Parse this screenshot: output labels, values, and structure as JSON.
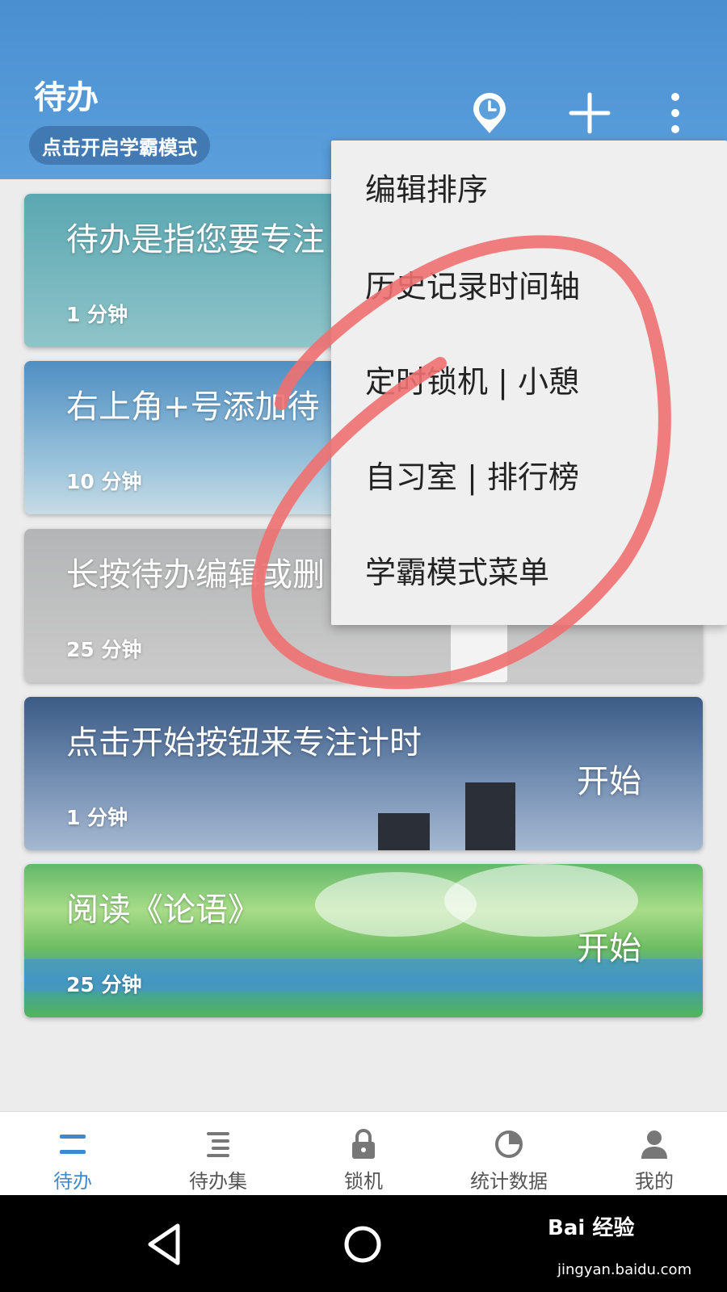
{
  "header": {
    "title": "待办",
    "mode_pill": "点击开启学霸模式",
    "icons": [
      "clock-icon",
      "plus-icon",
      "more-vertical-icon"
    ]
  },
  "cards": [
    {
      "title": "待办是指您要专注",
      "duration": "1 分钟",
      "start": ""
    },
    {
      "title": "右上角+号添加待",
      "duration": "10 分钟",
      "start": ""
    },
    {
      "title": "长按待办编辑或删",
      "duration": "25 分钟",
      "start": ""
    },
    {
      "title": "点击开始按钮来专注计时",
      "duration": "1 分钟",
      "start": "开始"
    },
    {
      "title": "阅读《论语》",
      "duration": "25 分钟",
      "start": "开始"
    }
  ],
  "menu": {
    "items": [
      "编辑排序",
      "历史记录时间轴",
      "定时锁机 | 小憩",
      "自习室 | 排行榜",
      "学霸模式菜单"
    ]
  },
  "annotation": {
    "color": "#f07070"
  },
  "bottom_nav": {
    "items": [
      {
        "label": "待办",
        "icon": "list-icon",
        "active": true
      },
      {
        "label": "待办集",
        "icon": "list-collection-icon",
        "active": false
      },
      {
        "label": "锁机",
        "icon": "lock-icon",
        "active": false
      },
      {
        "label": "统计数据",
        "icon": "pie-chart-icon",
        "active": false
      },
      {
        "label": "我的",
        "icon": "user-icon",
        "active": false
      }
    ],
    "active_color": "#3e8ad2"
  },
  "watermark": {
    "brand": "Bai 经验",
    "url": "jingyan.baidu.com"
  }
}
